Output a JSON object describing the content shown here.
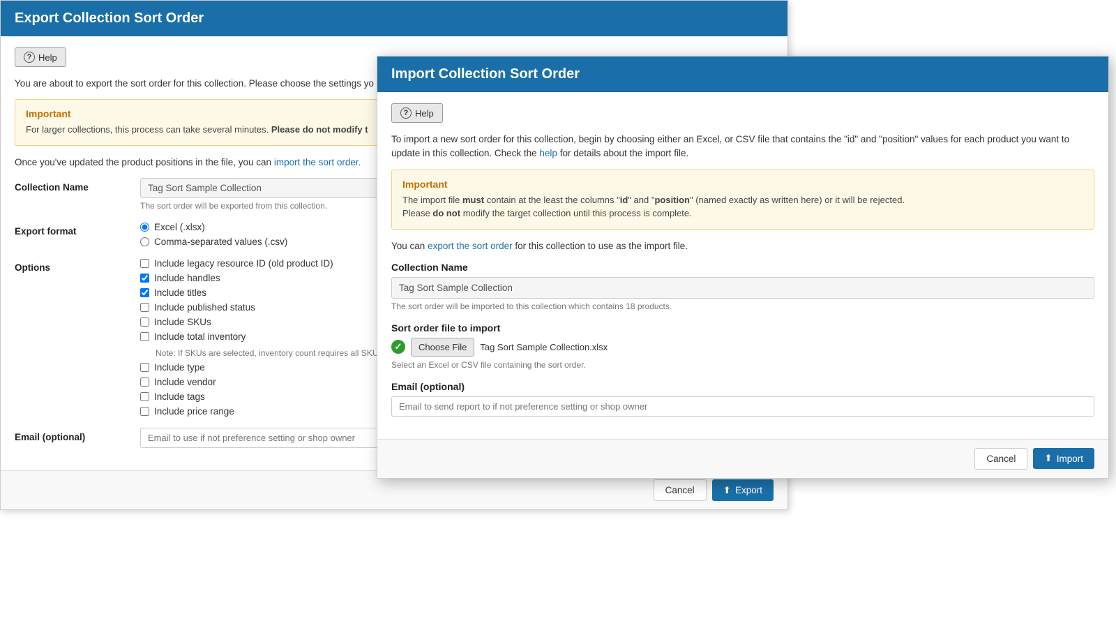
{
  "export": {
    "title": "Export Collection Sort Order",
    "help_button": "Help",
    "description": "You are about to export the sort order for this collection. Please choose the settings yo",
    "important": {
      "title": "Important",
      "text": "For larger collections, this process can take several minutes.",
      "bold": "Please do not modify t"
    },
    "import_link": "import the sort order.",
    "once_text": "Once you've updated the product positions in the file, you can",
    "collection_name_label": "Collection Name",
    "collection_name_value": "Tag Sort Sample Collection",
    "collection_name_hint": "The sort order will be exported from this collection.",
    "export_format_label": "Export format",
    "format_excel": "Excel (.xlsx)",
    "format_csv": "Comma-separated values (.csv)",
    "options_label": "Options",
    "options": [
      {
        "label": "Include legacy resource ID (old product ID)",
        "checked": false
      },
      {
        "label": "Include handles",
        "checked": true
      },
      {
        "label": "Include titles",
        "checked": true
      },
      {
        "label": "Include published status",
        "checked": false
      },
      {
        "label": "Include SKUs",
        "checked": false
      },
      {
        "label": "Include total inventory",
        "checked": false
      },
      {
        "label": "Include type",
        "checked": false
      },
      {
        "label": "Include vendor",
        "checked": false
      },
      {
        "label": "Include tags",
        "checked": false
      },
      {
        "label": "Include price range",
        "checked": false
      }
    ],
    "sku_note": "Note: If SKUs are selected, inventory count requires all SKUs to",
    "email_label": "Email (optional)",
    "email_placeholder": "Email to use if not preference setting or shop owner",
    "cancel_label": "Cancel",
    "export_label": "Export"
  },
  "import": {
    "title": "Import Collection Sort Order",
    "help_button": "Help",
    "description_part1": "To import a new sort order for this collection, begin by choosing either an Excel, or CSV file that contains the \"id\" and \"position\" values for each product you want to update in this collection. Check the",
    "help_link": "help",
    "description_part2": "for details about the import file.",
    "important": {
      "title": "Important",
      "text_start": "The import file",
      "must": "must",
      "text_mid": "contain at the least the columns \"id\" and \"position\" (named exactly as written here) or it will be rejected.\nPlease",
      "do_not": "do not",
      "text_end": "modify the target collection until this process is complete."
    },
    "export_link_text": "export the sort order",
    "export_link_suffix": "for this collection to use as the import file.",
    "you_can": "You can",
    "collection_name_label": "Collection Name",
    "collection_name_value": "Tag Sort Sample Collection",
    "collection_name_hint": "The sort order will be imported to this collection which contains 18 products.",
    "sort_order_label": "Sort order file to import",
    "file_name": "Tag Sort Sample Collection.xlsx",
    "file_hint": "Select an Excel or CSV file containing the sort order.",
    "choose_file_label": "Choose File",
    "email_label": "Email (optional)",
    "email_placeholder": "Email to send report to if not preference setting or shop owner",
    "cancel_label": "Cancel",
    "import_label": "Import"
  }
}
